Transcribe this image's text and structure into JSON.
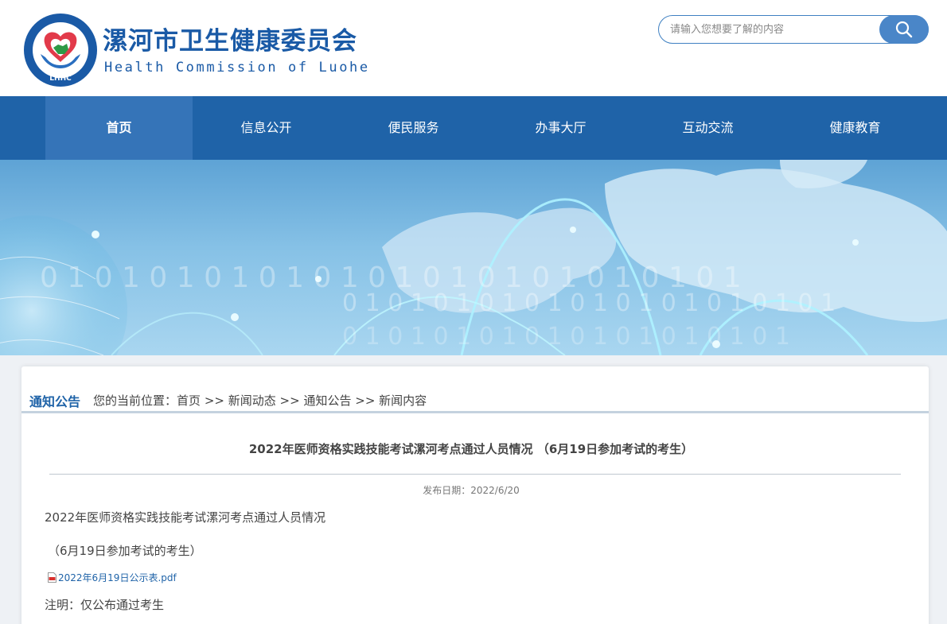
{
  "header": {
    "title_cn": "漯河市卫生健康委员会",
    "title_en": "Health Commission of Luohe",
    "logo_letters": "LHHC",
    "brand_color": "#1a5aa6"
  },
  "search": {
    "placeholder": "请输入您想要了解的内容",
    "button_icon": "search-icon"
  },
  "nav": {
    "items": [
      {
        "label": "首页",
        "active": true
      },
      {
        "label": "信息公开",
        "active": false
      },
      {
        "label": "便民服务",
        "active": false
      },
      {
        "label": "办事大厅",
        "active": false
      },
      {
        "label": "互动交流",
        "active": false
      },
      {
        "label": "健康教育",
        "active": false
      }
    ],
    "bg_color": "#1f63a8",
    "active_color": "#3574b8"
  },
  "banner": {
    "binary_row_1": "0 1 0 1 0 1 0 1 0 1 0 1 0 1 0 1 0 1 0 1 0 1 0 1 0 1",
    "binary_row_2": "0 1 0 1 0 1 0 1 0 1 0 1 0 1 0 1 0 1 0 1 0 1",
    "binary_row_3": "0 1 0 1 0 1 0 1 0 1 0 1 0 1 0 1 0 1 0 1"
  },
  "breadcrumb": {
    "section": "通知公告",
    "prefix": "您的当前位置：",
    "items": [
      "首页",
      "新闻动态",
      "通知公告",
      "新闻内容"
    ],
    "separator": ">>"
  },
  "article": {
    "title": "2022年医师资格实践技能考试漯河考点通过人员情况  （6月19日参加考试的考生）",
    "publish_date": "发布日期：2022/6/20",
    "para_1": "2022年医师资格实践技能考试漯河考点通过人员情况",
    "para_2": "（6月19日参加考试的考生）",
    "attachment": "2022年6月19日公示表.pdf",
    "attachment_icon": "pdf-icon",
    "note": "注明：仅公布通过考生"
  }
}
